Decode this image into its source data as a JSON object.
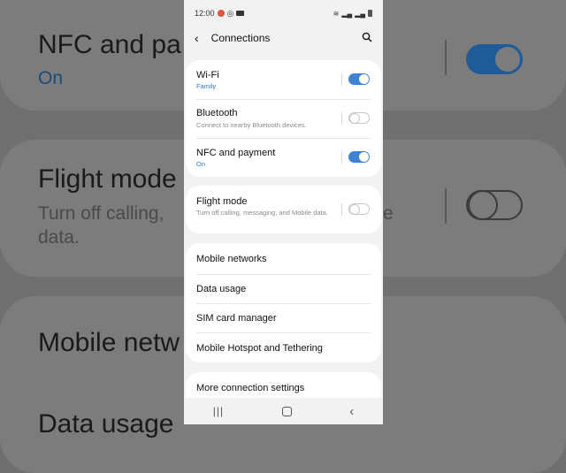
{
  "status": {
    "time": "12:00"
  },
  "header": {
    "title": "Connections"
  },
  "items": [
    {
      "label": "Wi-Fi",
      "sub": "Family"
    },
    {
      "label": "Bluetooth",
      "sub": "Connect to nearby Bluetooth devices."
    },
    {
      "label": "NFC and payment",
      "sub": "On"
    },
    {
      "label": "Flight mode",
      "sub": "Turn off calling, messaging, and Mobile data."
    },
    {
      "label": "Mobile networks"
    },
    {
      "label": "Data usage"
    },
    {
      "label": "SIM card manager"
    },
    {
      "label": "Mobile Hotspot and Tethering"
    },
    {
      "label": "More connection settings"
    }
  ],
  "toggles": {
    "wifi": true,
    "bluetooth": false,
    "nfc": true,
    "flight_mode": false
  },
  "background": {
    "nfc_title": "NFC and pa",
    "nfc_sub": "On",
    "flight_title": "Flight mode",
    "flight_sub1": "Turn off calling,",
    "flight_sub1_right": "e",
    "flight_sub2": "data.",
    "mobile_title": "Mobile netw",
    "data_title": "Data usage"
  },
  "colors": {
    "accent": "#3e82d6",
    "subtext_blue": "#2a7ac9",
    "card": "#ffffff",
    "screen_bg": "#f2f2f2"
  }
}
